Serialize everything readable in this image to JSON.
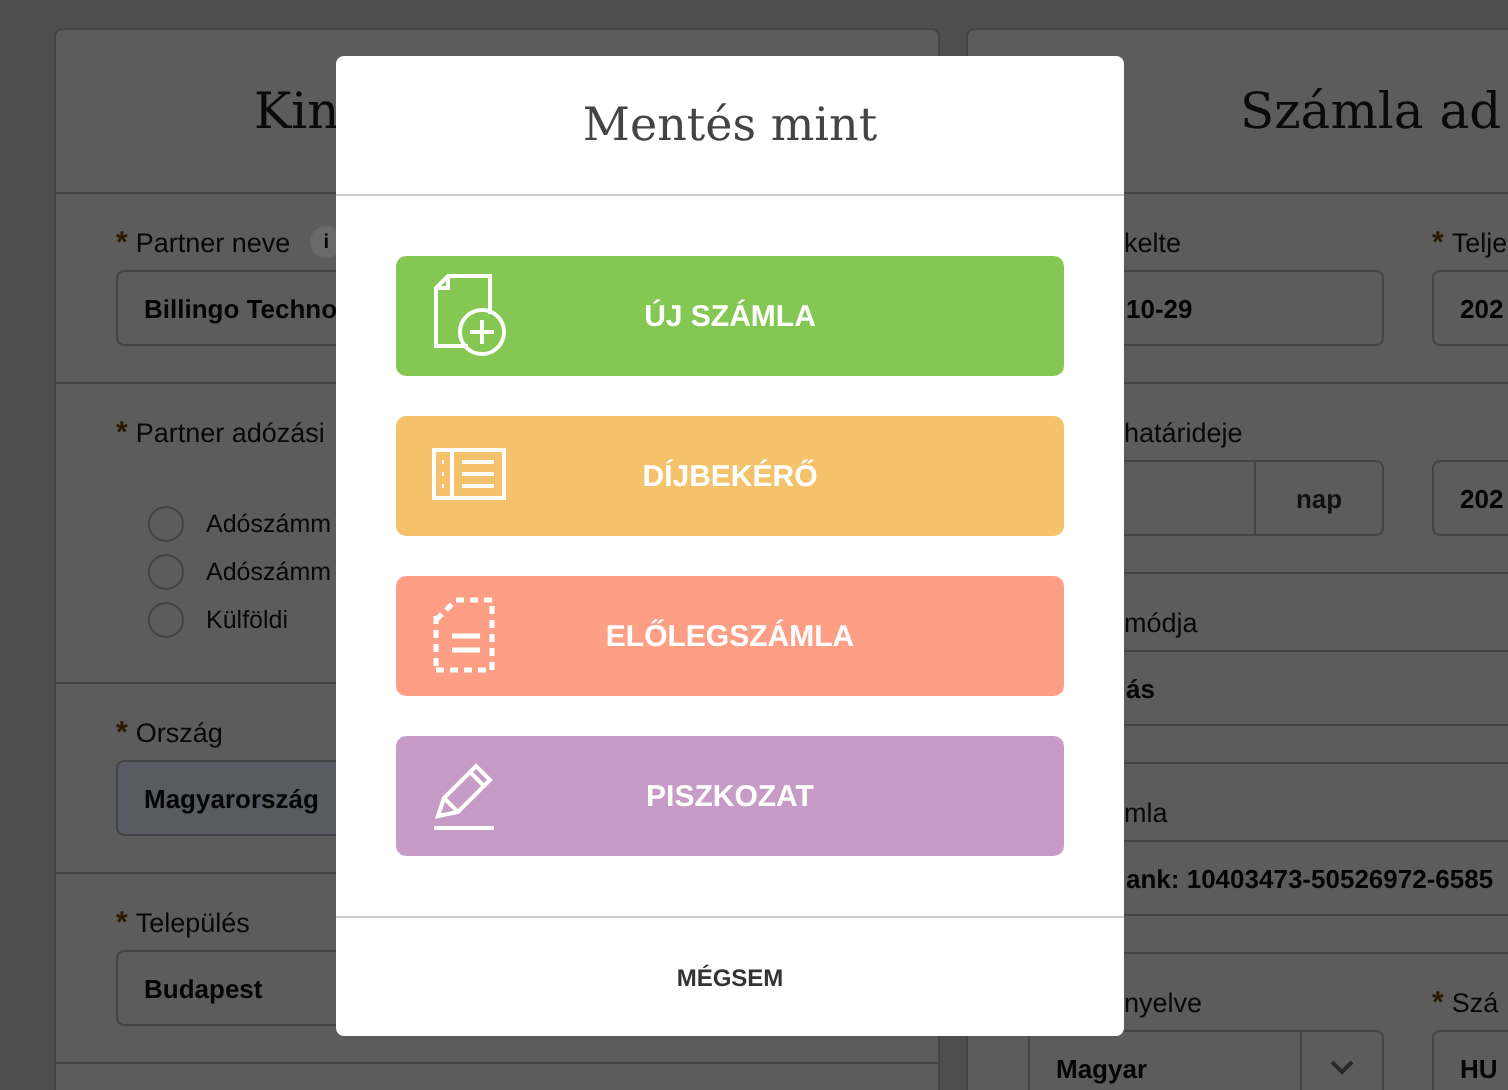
{
  "background_form": {
    "left_panel": {
      "title": "Kin",
      "sections": [
        {
          "kind": "field",
          "label": "Partner neve",
          "required_mark": "*",
          "info": "i",
          "value": "Billingo Techno"
        },
        {
          "kind": "radio",
          "label": "Partner adózási",
          "required_mark": "*",
          "options": [
            {
              "label": "Adószámm",
              "selected": false
            },
            {
              "label": "Adószámm",
              "selected": false
            },
            {
              "label": "Külföldi",
              "selected": false
            }
          ]
        },
        {
          "kind": "field",
          "label": "Ország",
          "required_mark": "*",
          "value": "Magyarország",
          "highlighted": true
        },
        {
          "kind": "field",
          "label": "Település",
          "required_mark": "*",
          "value": "Budapest"
        }
      ]
    },
    "right_panel": {
      "title": "Számla ad",
      "rows": [
        [
          {
            "kind": "text",
            "label": "kelte",
            "value": "10-29"
          },
          {
            "kind": "text",
            "label": "Telje",
            "required_mark": "*",
            "value": "202"
          }
        ],
        [
          {
            "kind": "suffix",
            "label": "határideje",
            "suffix": "nap"
          },
          {
            "kind": "text",
            "value": "202"
          }
        ],
        [
          {
            "kind": "text",
            "label": "módja",
            "value": "ás"
          }
        ],
        [
          {
            "kind": "text",
            "label": "mla",
            "value": "ank: 10403473-50526972-6585"
          }
        ],
        [
          {
            "kind": "select",
            "label": "nyelve",
            "value": "Magyar"
          },
          {
            "kind": "text",
            "label": "Szá",
            "required_mark": "*",
            "value": "HU"
          }
        ]
      ]
    }
  },
  "dialog": {
    "title": "Mentés mint",
    "options": [
      {
        "kind": "new-document",
        "label": "ÚJ SZÁMLA",
        "color": "#84c753"
      },
      {
        "kind": "list",
        "label": "DÍJBEKÉRŐ",
        "color": "#f3c26a"
      },
      {
        "kind": "dashed-document",
        "label": "ELŐLEGSZÁMLA",
        "color": "#fe9f85"
      },
      {
        "kind": "pencil",
        "label": "PISZKOZAT",
        "color": "#c69cc6"
      }
    ],
    "cancel": "MÉGSEM"
  }
}
